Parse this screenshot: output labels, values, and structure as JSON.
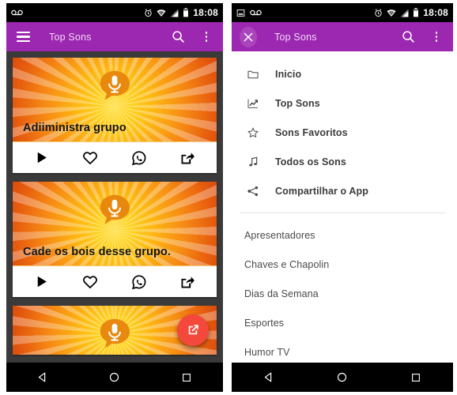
{
  "status_bar": {
    "time": "18:08",
    "left_icons_phone1": [
      "voicemail-icon"
    ],
    "left_icons_phone2": [
      "image-icon",
      "voicemail-icon"
    ],
    "right_icons": [
      "alarm-icon",
      "wifi-icon",
      "signal-icon",
      "battery-icon"
    ]
  },
  "app_bar": {
    "title": "Top Sons",
    "menu_icon": "hamburger-icon",
    "close_icon": "close-icon",
    "search_icon": "search-icon",
    "overflow_icon": "overflow-menu-icon",
    "color": "#9c27b0"
  },
  "sound_list": {
    "cards": [
      {
        "title": "Adiiministra grupo",
        "actions": [
          "play",
          "favorite",
          "whatsapp",
          "share"
        ]
      },
      {
        "title": "Cade os bois desse grupo.",
        "actions": [
          "play",
          "favorite",
          "whatsapp",
          "share"
        ]
      },
      {
        "title": "",
        "actions": []
      }
    ],
    "action_labels": {
      "play": "play-icon",
      "favorite": "heart-icon",
      "whatsapp": "whatsapp-icon",
      "share": "share-icon"
    },
    "fab": {
      "icon": "open-in-new-icon",
      "color": "#f4483c"
    }
  },
  "drawer": {
    "primary_items": [
      {
        "icon": "folder-icon",
        "label": "Inicio"
      },
      {
        "icon": "trending-up-icon",
        "label": "Top Sons"
      },
      {
        "icon": "star-outline-icon",
        "label": "Sons Favoritos"
      },
      {
        "icon": "music-note-icon",
        "label": "Todos os Sons"
      },
      {
        "icon": "share-nodes-icon",
        "label": "Compartilhar o App"
      }
    ],
    "category_items": [
      {
        "label": "Apresentadores"
      },
      {
        "label": "Chaves e Chapolin"
      },
      {
        "label": "Dias da Semana"
      },
      {
        "label": "Esportes"
      },
      {
        "label": "Humor TV"
      }
    ]
  },
  "nav_bar": {
    "back": "back-triangle-icon",
    "home": "home-circle-icon",
    "recents": "recents-square-icon"
  }
}
